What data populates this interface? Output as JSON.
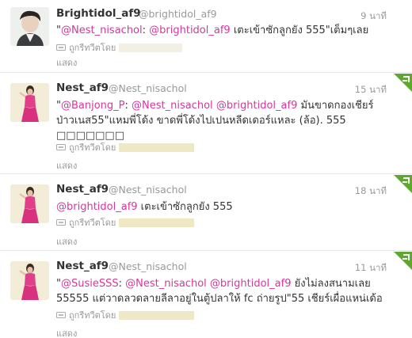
{
  "timeline": {
    "show_label": "แสดง",
    "retweeted_by_label": "ถูกรีทวีตโดย",
    "tweets": [
      {
        "name": "Brightidol_af9",
        "handle": "@brightidol_af9",
        "time": "9 นาที",
        "text_parts": [
          {
            "t": "\"",
            "mention": false
          },
          {
            "t": "@Nest_nisachol",
            "mention": true
          },
          {
            "t": ": ",
            "mention": false
          },
          {
            "t": "@brightidol_af9",
            "mention": true
          },
          {
            "t": " เตะเข้าซักลูกยัง 555\"เต็มๆเลย",
            "mention": false
          }
        ]
      },
      {
        "name": "Nest_af9",
        "handle": "@Nest_nisachol",
        "time": "15 นาที",
        "text_parts": [
          {
            "t": "\"",
            "mention": false
          },
          {
            "t": "@Banjong_P",
            "mention": true
          },
          {
            "t": ": ",
            "mention": false
          },
          {
            "t": "@Nest_nisachol",
            "mention": true
          },
          {
            "t": " ",
            "mention": false
          },
          {
            "t": "@brightidol_af9",
            "mention": true
          },
          {
            "t": " มันขาดกองเชียร์ป่าวเนส55\"แหมพี่โด้ง ขาดพี่โด้งไปเปนหลีดเดอร์แหละ (ล้อ). 555 □□□□□□□",
            "mention": false
          }
        ]
      },
      {
        "name": "Nest_af9",
        "handle": "@Nest_nisachol",
        "time": "18 นาที",
        "text_parts": [
          {
            "t": "@brightidol_af9",
            "mention": true
          },
          {
            "t": " เตะเข้าซักลูกยัง 555",
            "mention": false
          }
        ]
      },
      {
        "name": "Nest_af9",
        "handle": "@Nest_nisachol",
        "time": "11 นาที",
        "text_parts": [
          {
            "t": "\"",
            "mention": false
          },
          {
            "t": "@SusieSSS",
            "mention": true
          },
          {
            "t": ": ",
            "mention": false
          },
          {
            "t": "@Nest_nisachol",
            "mention": true
          },
          {
            "t": " ",
            "mention": false
          },
          {
            "t": "@brightidol_af9",
            "mention": true
          },
          {
            "t": " ยังไม่ลงสนามเลย 55555 แต่วาดลวดลายลีลาอยู่ในตู้ปลาให้ fc ถ่ายรูป\"55 เชียร์เผื่อแหน่เด้อ",
            "mention": false
          }
        ]
      }
    ]
  },
  "colors": {
    "mention": "#d6379c",
    "meta": "#999999",
    "corner_green": "#5fa82f"
  }
}
